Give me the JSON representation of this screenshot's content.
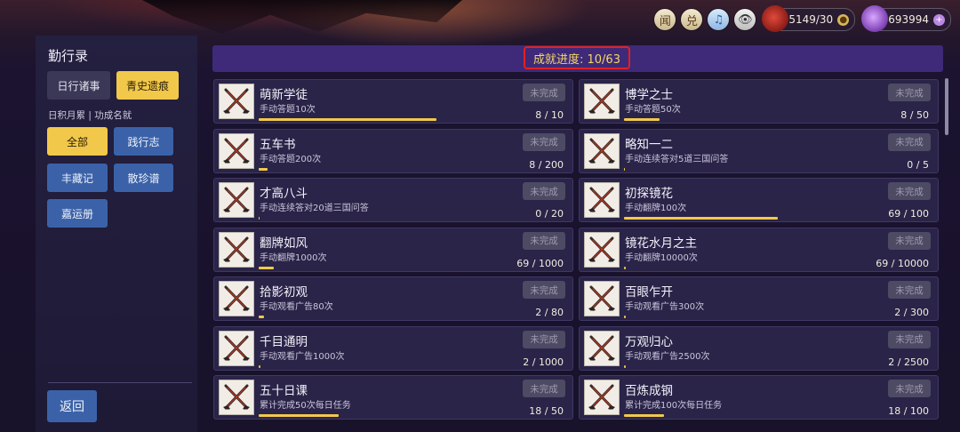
{
  "topbar": {
    "buttons": [
      {
        "name": "news-icon",
        "glyph": "闻"
      },
      {
        "name": "exchange-icon",
        "glyph": "兑"
      },
      {
        "name": "music-icon",
        "glyph": "♫"
      },
      {
        "name": "eye-icon",
        "glyph": "👁"
      }
    ],
    "stamina": "5149/30",
    "currency": "693994"
  },
  "sidebar": {
    "title": "勤行录",
    "tabs": [
      "日行诸事",
      "青史遗痕"
    ],
    "subtitle": "日积月累 | 功成名就",
    "categories": [
      "全部",
      "践行志",
      "丰藏记",
      "散珍谱",
      "嘉运册"
    ],
    "back": "返回"
  },
  "header": {
    "progress": "成就进度: 10/63"
  },
  "achievements": [
    {
      "name": "萌新学徒",
      "desc": "手动答题10次",
      "status": "未完成",
      "count": "8 / 10",
      "progress": 0.8
    },
    {
      "name": "博学之士",
      "desc": "手动答题50次",
      "status": "未完成",
      "count": "8 / 50",
      "progress": 0.16
    },
    {
      "name": "五车书",
      "desc": "手动答题200次",
      "status": "未完成",
      "count": "8 / 200",
      "progress": 0.04
    },
    {
      "name": "略知一二",
      "desc": "手动连续答对5道三国问答",
      "status": "未完成",
      "count": "0 / 5",
      "progress": 0.0
    },
    {
      "name": "才高八斗",
      "desc": "手动连续答对20道三国问答",
      "status": "未完成",
      "count": "0 / 20",
      "progress": 0.0
    },
    {
      "name": "初探镜花",
      "desc": "手动翻牌100次",
      "status": "未完成",
      "count": "69 / 100",
      "progress": 0.69
    },
    {
      "name": "翻牌如风",
      "desc": "手动翻牌1000次",
      "status": "未完成",
      "count": "69 / 1000",
      "progress": 0.069
    },
    {
      "name": "镜花水月之主",
      "desc": "手动翻牌10000次",
      "status": "未完成",
      "count": "69 / 10000",
      "progress": 0.0069
    },
    {
      "name": "拾影初观",
      "desc": "手动观看广告80次",
      "status": "未完成",
      "count": "2 / 80",
      "progress": 0.025
    },
    {
      "name": "百眼乍开",
      "desc": "手动观看广告300次",
      "status": "未完成",
      "count": "2 / 300",
      "progress": 0.0067
    },
    {
      "name": "千目通明",
      "desc": "手动观看广告1000次",
      "status": "未完成",
      "count": "2 / 1000",
      "progress": 0.002
    },
    {
      "name": "万观归心",
      "desc": "手动观看广告2500次",
      "status": "未完成",
      "count": "2 / 2500",
      "progress": 0.0008
    },
    {
      "name": "五十日课",
      "desc": "累计完成50次每日任务",
      "status": "未完成",
      "count": "18 / 50",
      "progress": 0.36
    },
    {
      "name": "百炼成钢",
      "desc": "累计完成100次每日任务",
      "status": "未完成",
      "count": "18 / 100",
      "progress": 0.18
    }
  ],
  "colors": {
    "accent": "#f2c84a",
    "category": "#3b62a8",
    "header": "#3e2a78",
    "highlight": "#e32020"
  }
}
